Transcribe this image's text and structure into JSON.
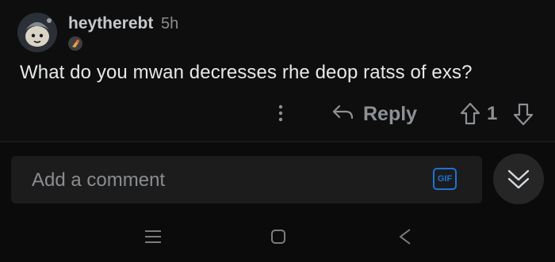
{
  "comment": {
    "username": "heytherebt",
    "timestamp": "5h",
    "body": "What do you mwan decresses rhe deop ratss of exs?",
    "score": "1"
  },
  "actions": {
    "reply_label": "Reply"
  },
  "composer": {
    "placeholder": "Add a comment",
    "gif_label": "GIF"
  },
  "colors": {
    "background": "#0b0b0b",
    "text_primary": "#e6e8ea",
    "text_muted": "#8d9094",
    "gif_accent": "#1e73d3"
  },
  "icons": [
    "avatar",
    "flair-icon",
    "more-options-icon",
    "reply-arrow-icon",
    "upvote-icon",
    "downvote-icon",
    "gif-icon",
    "collapse-chevron-icon",
    "nav-menu-icon",
    "nav-home-icon",
    "nav-back-icon"
  ]
}
